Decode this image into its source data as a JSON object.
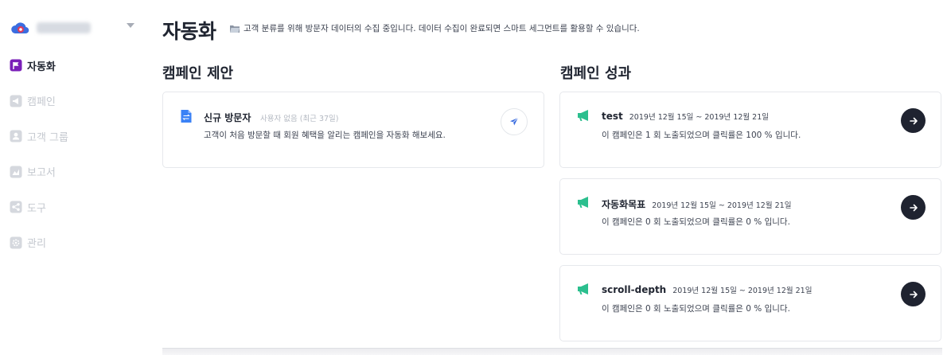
{
  "sidebar": {
    "brand": {
      "name": "workspace"
    },
    "items": [
      {
        "label": "자동화",
        "icon": "flag-icon",
        "active": true
      },
      {
        "label": "캠페인",
        "icon": "megaphone-icon",
        "active": false
      },
      {
        "label": "고객 그룹",
        "icon": "user-icon",
        "active": false
      },
      {
        "label": "보고서",
        "icon": "chart-icon",
        "active": false
      },
      {
        "label": "도구",
        "icon": "share-icon",
        "active": false
      },
      {
        "label": "관리",
        "icon": "gear-icon",
        "active": false
      }
    ]
  },
  "header": {
    "title": "자동화",
    "notice": "고객 분류를 위해 방문자 데이터의 수집 중입니다. 데이터 수집이 완료되면 스마트 세그먼트를 활용할 수 있습니다."
  },
  "proposals": {
    "section_title": "캠페인 제안",
    "items": [
      {
        "title": "신규 방문자",
        "meta": "사용자 없음 (최근 37일)",
        "description": "고객이 처음 방문할 때 회원 혜택을 알리는 캠페인을 자동화 해보세요."
      }
    ]
  },
  "performance": {
    "section_title": "캠페인 성과",
    "items": [
      {
        "name": "test",
        "range": "2019년 12월 15일 ~ 2019년 12월 21일",
        "description": "이 캠페인은 1 회 노출되었으며 클릭률은 100 % 입니다."
      },
      {
        "name": "자동화목표",
        "range": "2019년 12월 15일 ~ 2019년 12월 21일",
        "description": "이 캠페인은 0 회 노출되었으며 클릭률은 0 % 입니다."
      },
      {
        "name": "scroll-depth",
        "range": "2019년 12월 15일 ~ 2019년 12월 21일",
        "description": "이 캠페인은 0 회 노출되었으며 클릭률은 0 % 입니다."
      }
    ]
  },
  "colors": {
    "brand": "#3b6de0",
    "active_nav": "#7a1fb8",
    "megaphone": "#2bbf8e",
    "dark_button": "#1f2330"
  }
}
